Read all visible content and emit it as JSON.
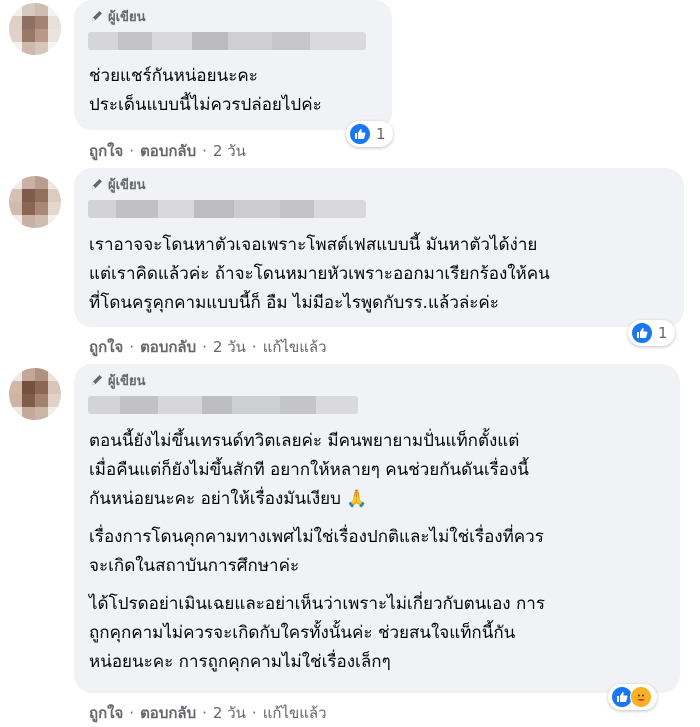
{
  "comments": [
    {
      "author_label": "ผู้เขียน",
      "text": [
        "ช่วยแชร์กันหน่อยนะคะ\nประเด็นแบบนี้ไม่ควรปล่อยไปค่ะ"
      ],
      "reaction_count": "1",
      "reaction_icons": [
        "like-icon"
      ],
      "actions": {
        "like": "ถูกใจ",
        "reply": "ตอบกลับ",
        "time": "2 วัน"
      }
    },
    {
      "author_label": "ผู้เขียน",
      "text": [
        "เราอาจจะโดนหาตัวเจอเพราะโพสต์เฟสแบบนี้ มันหาตัวได้ง่าย\nแต่เราคิดแล้วค่ะ ถ้าจะโดนหมายหัวเพราะออกมาเรียกร้องให้คน\nที่โดนครูคุกคามแบบนี้ก็ อืม ไม่มีอะไรพูดกับรร.แล้วล่ะค่ะ"
      ],
      "reaction_count": "1",
      "reaction_icons": [
        "like-icon"
      ],
      "actions": {
        "like": "ถูกใจ",
        "reply": "ตอบกลับ",
        "time": "2 วัน",
        "edited": "แก้ไขแล้ว"
      }
    },
    {
      "author_label": "ผู้เขียน",
      "text": [
        "ตอนนี้ยังไม่ขึ้นเทรนด์ทวิตเลยค่ะ มีคนพยายามปั่นแท็กตั้งแต่\nเมื่อคืนแต่ก็ยังไม่ขึ้นสักที อยากให้หลายๆ คนช่วยกันดันเรื่องนี้\nกันหน่อยนะคะ อย่าให้เรื่องมันเงียบ 🙏",
        "เรื่องการโดนคุกคามทางเพศไม่ใช่เรื่องปกติและไม่ใช่เรื่องที่ควร\nจะเกิดในสถาบันการศึกษาค่ะ",
        "ได้โปรดอย่าเมินเฉยและอย่าเห็นว่าเพราะไม่เกี่ยวกับตนเอง การ\nถูกคุกคามไม่ควรจะเกิดกับใครทั้งนั้นค่ะ ช่วยสนใจแท็กนี้กัน\nหน่อยนะคะ การถูกคุกคามไม่ใช่เรื่องเล็กๆ"
      ],
      "reaction_count": "",
      "reaction_icons": [
        "like-icon",
        "care-icon"
      ],
      "actions": {
        "like": "ถูกใจ",
        "reply": "ตอบกลับ",
        "time": "2 วัน",
        "edited": "แก้ไขแล้ว"
      }
    }
  ],
  "colors": {
    "bubble": "#f0f2f5",
    "meta_text": "#65676b",
    "body_text": "#050505",
    "like_blue": "#1877f2",
    "care_yellow": "#f7b125"
  }
}
